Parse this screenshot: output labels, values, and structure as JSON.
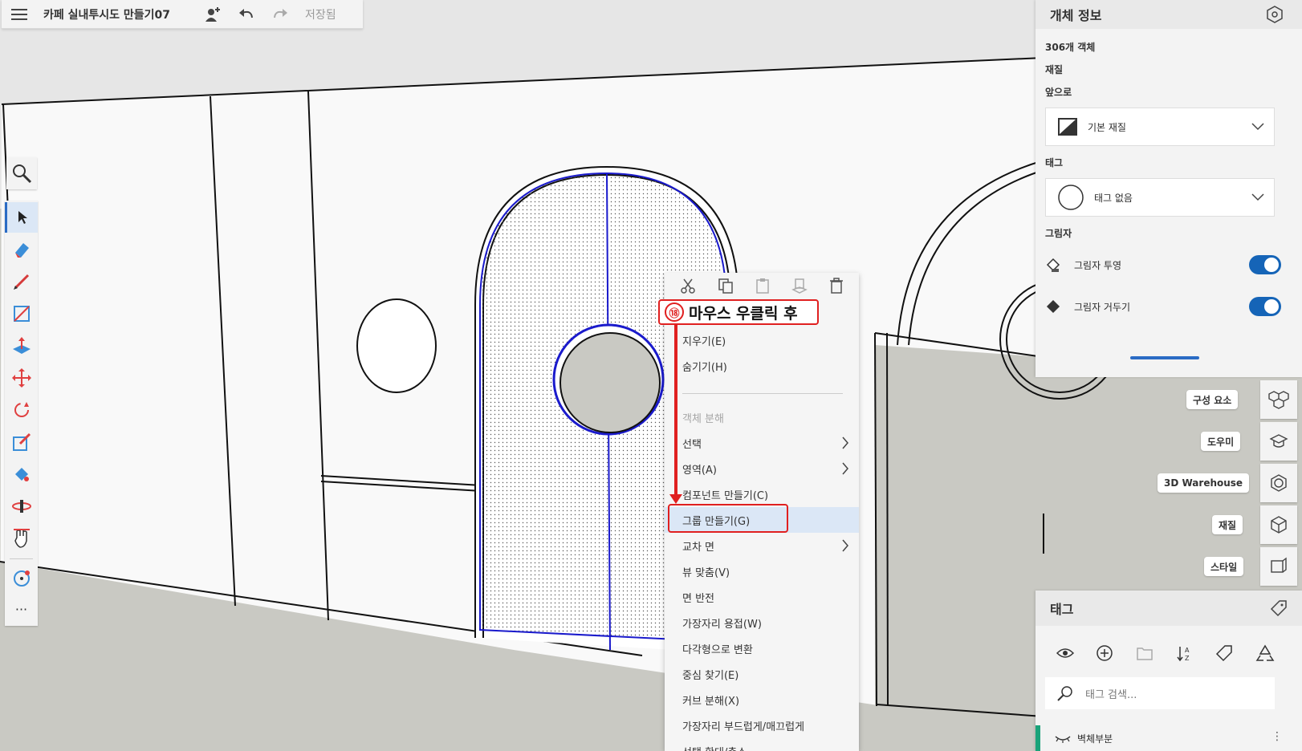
{
  "app": {
    "title": "카페 실내투시도 만들기07",
    "saved_status": "저장됨"
  },
  "icons": {
    "menu": "hamburger-icon",
    "share": "add-user-icon",
    "undo": "undo-icon",
    "redo": "redo-icon",
    "search": "magnifier-icon"
  },
  "toolbar": {
    "tools": [
      {
        "name": "select-tool",
        "icon": "arrow-icon"
      },
      {
        "name": "eraser-tool",
        "icon": "eraser-icon"
      },
      {
        "name": "pencil-tool",
        "icon": "pencil-icon"
      },
      {
        "name": "rectangle-tool",
        "icon": "rectangle-icon"
      },
      {
        "name": "push-pull-tool",
        "icon": "push-pull-icon"
      },
      {
        "name": "move-tool",
        "icon": "move-icon"
      },
      {
        "name": "rotate-tool",
        "icon": "rotate-icon"
      },
      {
        "name": "scale-tool",
        "icon": "scale-icon"
      },
      {
        "name": "paint-bucket-tool",
        "icon": "paint-icon"
      },
      {
        "name": "orbit-tool",
        "icon": "orbit-icon"
      },
      {
        "name": "pan-tool",
        "icon": "hand-icon"
      },
      {
        "name": "tape-measure-tool",
        "icon": "tape-icon"
      }
    ],
    "more_label": "···"
  },
  "context_menu": {
    "items": [
      {
        "label": "지우기(E)",
        "disabled": false,
        "submenu": false,
        "highlight": false
      },
      {
        "label": "숨기기(H)",
        "disabled": false,
        "submenu": false,
        "highlight": false
      },
      {
        "label": "객체 분해",
        "disabled": true,
        "submenu": false,
        "highlight": false
      },
      {
        "label": "선택",
        "disabled": false,
        "submenu": true,
        "highlight": false
      },
      {
        "label": "영역(A)",
        "disabled": false,
        "submenu": true,
        "highlight": false
      },
      {
        "label": "컴포넌트 만들기(C)",
        "disabled": false,
        "submenu": false,
        "highlight": false
      },
      {
        "label": "그룹 만들기(G)",
        "disabled": false,
        "submenu": false,
        "highlight": true
      },
      {
        "label": "교차 면",
        "disabled": false,
        "submenu": true,
        "highlight": false
      },
      {
        "label": "뷰 맞춤(V)",
        "disabled": false,
        "submenu": false,
        "highlight": false
      },
      {
        "label": "면 반전",
        "disabled": false,
        "submenu": false,
        "highlight": false
      },
      {
        "label": "가장자리 용접(W)",
        "disabled": false,
        "submenu": false,
        "highlight": false
      },
      {
        "label": "다각형으로 변환",
        "disabled": false,
        "submenu": false,
        "highlight": false
      },
      {
        "label": "중심 찾기(E)",
        "disabled": false,
        "submenu": false,
        "highlight": false
      },
      {
        "label": "커브 분해(X)",
        "disabled": false,
        "submenu": false,
        "highlight": false
      },
      {
        "label": "가장자리 부드럽게/매끄럽게",
        "disabled": false,
        "submenu": false,
        "highlight": false
      },
      {
        "label": "선택 확대/축소",
        "disabled": false,
        "submenu": false,
        "highlight": false
      }
    ]
  },
  "annotation": {
    "number": "⑱",
    "text": "마우스 우클릭 후"
  },
  "entity_info": {
    "title": "개체 정보",
    "count": "306개 객체",
    "material_label": "재질",
    "front_label": "앞으로",
    "material_value": "기본 재질",
    "tag_label": "태그",
    "tag_value": "태그 없음",
    "shadow_label": "그림자",
    "cast_shadow": "그림자 투영",
    "receive_shadow": "그림자 거두기"
  },
  "side_panels": [
    {
      "label": "구성 요소",
      "icon": "components-icon"
    },
    {
      "label": "도우미",
      "icon": "instructor-icon"
    },
    {
      "label": "3D Warehouse",
      "icon": "warehouse-icon"
    },
    {
      "label": "재질",
      "icon": "materials-icon"
    },
    {
      "label": "스타일",
      "icon": "styles-icon"
    }
  ],
  "tags_panel": {
    "title": "태그",
    "search_placeholder": "태그 검색...",
    "tag_name": "벽체부분",
    "more": "⋮"
  },
  "colors": {
    "accent": "#1564b7",
    "annotation": "#e02020",
    "selection": "#1a1acc",
    "tag_color": "#1aa37a"
  }
}
